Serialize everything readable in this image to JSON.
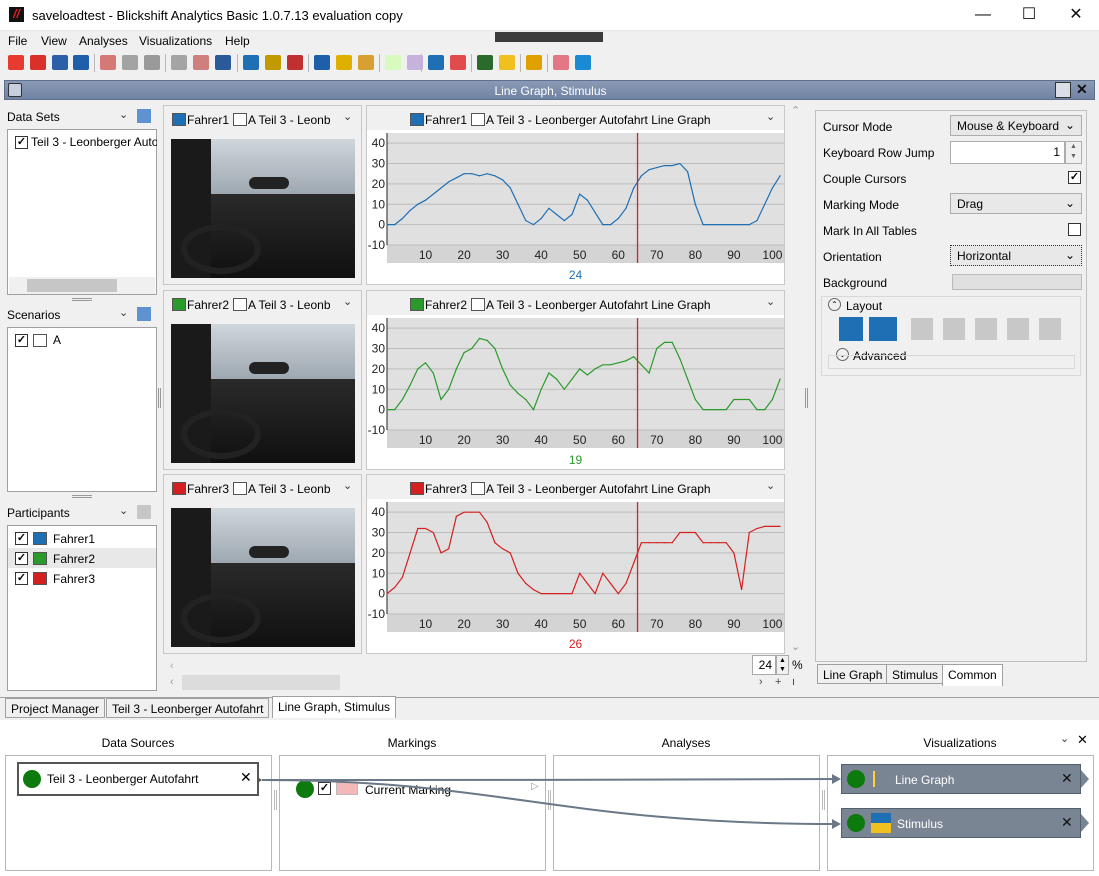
{
  "window": {
    "title": "saveloadtest - Blickshift Analytics Basic 1.0.7.13 evaluation copy",
    "min": "—",
    "max": "☐",
    "close": "✕"
  },
  "menu": [
    "File",
    "View",
    "Analyses",
    "Visualizations",
    "Help"
  ],
  "document": {
    "title": "Line Graph, Stimulus"
  },
  "left": {
    "datasets": {
      "title": "Data Sets",
      "items": [
        "Teil 3 - Leonberger Autofahrt"
      ]
    },
    "scenarios": {
      "title": "Scenarios",
      "items": [
        "A"
      ]
    },
    "participants": {
      "title": "Participants",
      "items": [
        {
          "name": "Fahrer1",
          "color": "#1f6fb4"
        },
        {
          "name": "Fahrer2",
          "color": "#2a9a2a"
        },
        {
          "name": "Fahrer3",
          "color": "#d42020"
        }
      ]
    }
  },
  "rows": [
    {
      "video_label": "Fahrer1",
      "video_sub": "A Teil 3 - Leonb",
      "graph_label": "Fahrer1",
      "graph_sub": "A Teil 3 - Leonberger Autofahrt Line Graph",
      "cursor_value": "24",
      "color": "#1f6fb4"
    },
    {
      "video_label": "Fahrer2",
      "video_sub": "A Teil 3 - Leonb",
      "graph_label": "Fahrer2",
      "graph_sub": "A Teil 3 - Leonberger Autofahrt Line Graph",
      "cursor_value": "19",
      "color": "#2a9a2a"
    },
    {
      "video_label": "Fahrer3",
      "video_sub": "A Teil 3 - Leonb",
      "graph_label": "Fahrer3",
      "graph_sub": "A Teil 3 - Leonberger Autofahrt Line Graph",
      "cursor_value": "26",
      "color": "#d42020"
    }
  ],
  "zoom": {
    "value": "24",
    "unit": "%",
    "plus": "+"
  },
  "properties": {
    "cursor_mode_label": "Cursor Mode",
    "cursor_mode_value": "Mouse & Keyboard",
    "row_jump_label": "Keyboard Row Jump",
    "row_jump_value": "1",
    "couple_label": "Couple Cursors",
    "couple_checked": true,
    "marking_label": "Marking Mode",
    "marking_value": "Drag",
    "markall_label": "Mark In All Tables",
    "markall_checked": false,
    "orientation_label": "Orientation",
    "orientation_value": "Horizontal",
    "background_label": "Background",
    "layout_label": "Layout",
    "advanced_label": "Advanced",
    "tabs": [
      "Line Graph",
      "Stimulus",
      "Common"
    ]
  },
  "bottom_tabs": [
    "Project Manager",
    "Teil 3 - Leonberger Autofahrt",
    "Line Graph, Stimulus"
  ],
  "workflow": {
    "columns": [
      "Data Sources",
      "Markings",
      "Analyses",
      "Visualizations"
    ],
    "source": "Teil 3 - Leonberger Autofahrt",
    "marking": "Current Marking",
    "vis": [
      "Line Graph",
      "Stimulus"
    ]
  },
  "chart_data": [
    {
      "type": "line",
      "title": "",
      "x": [
        0,
        2,
        4,
        6,
        8,
        10,
        12,
        14,
        16,
        18,
        20,
        22,
        24,
        26,
        28,
        30,
        32,
        34,
        36,
        38,
        40,
        42,
        44,
        46,
        48,
        50,
        52,
        54,
        56,
        58,
        60,
        62,
        64,
        66,
        68,
        70,
        72,
        74,
        76,
        78,
        80,
        82,
        84,
        86,
        88,
        90,
        92,
        94,
        96,
        98,
        100,
        102
      ],
      "series": [
        {
          "name": "Fahrer1",
          "values": [
            0,
            0,
            3,
            7,
            10,
            12,
            15,
            18,
            21,
            23,
            25,
            25,
            24,
            25,
            24,
            22,
            18,
            10,
            2,
            0,
            3,
            8,
            5,
            2,
            5,
            15,
            12,
            6,
            0,
            0,
            3,
            8,
            18,
            24,
            27,
            28,
            29,
            29,
            30,
            26,
            10,
            0,
            0,
            0,
            0,
            0,
            0,
            0,
            2,
            10,
            18,
            24
          ]
        }
      ],
      "ylim": [
        -10,
        45
      ],
      "xlim": [
        0,
        103
      ],
      "xticks": [
        10,
        20,
        30,
        40,
        50,
        60,
        70,
        80,
        90,
        100
      ],
      "yticks": [
        -10,
        0,
        10,
        20,
        30,
        40
      ]
    },
    {
      "type": "line",
      "title": "",
      "x": [
        0,
        2,
        4,
        6,
        8,
        10,
        12,
        14,
        16,
        18,
        20,
        22,
        24,
        26,
        28,
        30,
        32,
        34,
        36,
        38,
        40,
        42,
        44,
        46,
        48,
        50,
        52,
        54,
        56,
        58,
        60,
        62,
        64,
        66,
        68,
        70,
        72,
        74,
        76,
        78,
        80,
        82,
        84,
        86,
        88,
        90,
        92,
        94,
        96,
        98,
        100,
        102
      ],
      "series": [
        {
          "name": "Fahrer2",
          "values": [
            0,
            0,
            5,
            12,
            20,
            23,
            18,
            5,
            10,
            20,
            28,
            30,
            35,
            34,
            30,
            20,
            12,
            8,
            5,
            0,
            10,
            18,
            15,
            10,
            15,
            20,
            17,
            20,
            22,
            22,
            23,
            24,
            26,
            22,
            18,
            30,
            33,
            33,
            25,
            15,
            5,
            0,
            0,
            0,
            0,
            5,
            5,
            5,
            0,
            0,
            5,
            15
          ]
        }
      ],
      "ylim": [
        -10,
        45
      ],
      "xlim": [
        0,
        103
      ],
      "xticks": [
        10,
        20,
        30,
        40,
        50,
        60,
        70,
        80,
        90,
        100
      ],
      "yticks": [
        -10,
        0,
        10,
        20,
        30,
        40
      ]
    },
    {
      "type": "line",
      "title": "",
      "x": [
        0,
        2,
        4,
        6,
        8,
        10,
        12,
        14,
        16,
        18,
        20,
        22,
        24,
        26,
        28,
        30,
        32,
        34,
        36,
        38,
        40,
        42,
        44,
        46,
        48,
        50,
        52,
        54,
        56,
        58,
        60,
        62,
        64,
        66,
        68,
        70,
        72,
        74,
        76,
        78,
        80,
        82,
        84,
        86,
        88,
        90,
        92,
        94,
        96,
        98,
        100,
        102
      ],
      "series": [
        {
          "name": "Fahrer3",
          "values": [
            0,
            3,
            8,
            20,
            32,
            32,
            30,
            20,
            22,
            38,
            40,
            40,
            40,
            35,
            25,
            22,
            20,
            10,
            5,
            2,
            0,
            0,
            0,
            0,
            0,
            10,
            5,
            0,
            10,
            5,
            0,
            5,
            15,
            25,
            25,
            25,
            25,
            25,
            30,
            30,
            30,
            25,
            25,
            25,
            25,
            20,
            2,
            30,
            32,
            33,
            33,
            33
          ]
        }
      ],
      "ylim": [
        -10,
        45
      ],
      "xlim": [
        0,
        103
      ],
      "xticks": [
        10,
        20,
        30,
        40,
        50,
        60,
        70,
        80,
        90,
        100
      ],
      "yticks": [
        -10,
        0,
        10,
        20,
        30,
        40
      ]
    }
  ]
}
